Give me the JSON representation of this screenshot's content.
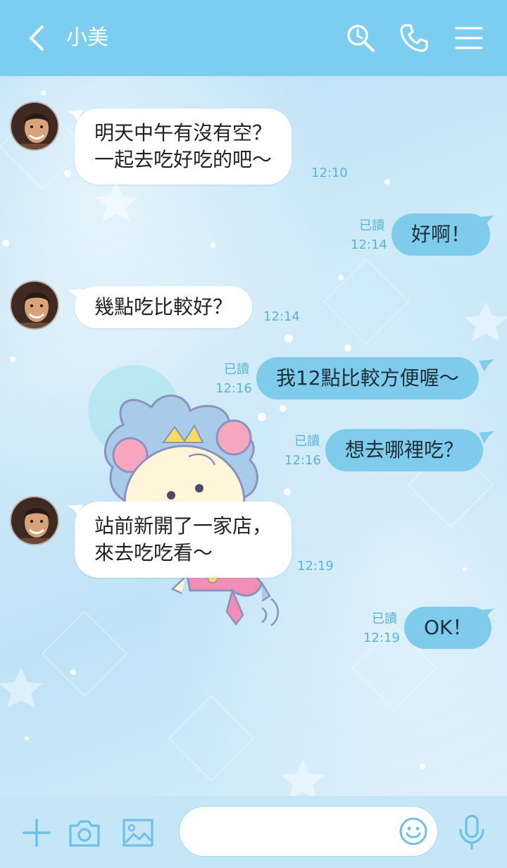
{
  "header": {
    "title": "小美",
    "icons": [
      "back-icon",
      "search-icon",
      "phone-icon",
      "menu-icon"
    ]
  },
  "messages": [
    {
      "side": "in",
      "lines": [
        "明天中午有沒有空？",
        "一起去吃好吃的吧～"
      ],
      "time": "12:10"
    },
    {
      "side": "out",
      "lines": [
        "好啊！"
      ],
      "read": "已讀",
      "time": "12:14"
    },
    {
      "side": "in",
      "lines": [
        "幾點吃比較好？"
      ],
      "time": "12:14"
    },
    {
      "side": "out",
      "lines": [
        "我12點比較方便喔～"
      ],
      "read": "已讀",
      "time": "12:16"
    },
    {
      "side": "out",
      "lines": [
        "想去哪裡吃？"
      ],
      "read": "已讀",
      "time": "12:16"
    },
    {
      "side": "in",
      "lines": [
        "站前新開了一家店，",
        "來去吃吃看～"
      ],
      "time": "12:19"
    },
    {
      "side": "out",
      "lines": [
        "OK！"
      ],
      "read": "已讀",
      "time": "12:19"
    }
  ],
  "footer": {
    "input_placeholder": "",
    "icons": [
      "plus-icon",
      "camera-icon",
      "image-icon",
      "emoji-icon",
      "microphone-icon"
    ]
  },
  "colors": {
    "header": "#7dcdf0",
    "outgoing_bubble": "#7ecbec",
    "incoming_bubble": "#ffffff",
    "meta_text": "#5bb3dc"
  }
}
